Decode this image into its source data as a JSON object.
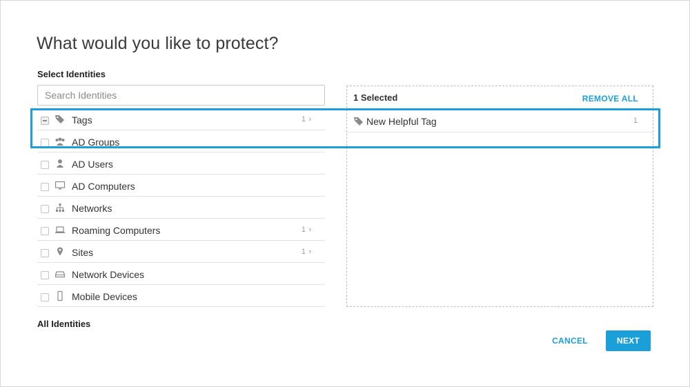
{
  "dialog": {
    "title": "What would you like to protect?",
    "section_label": "Select Identities",
    "footer_label": "All Identities"
  },
  "search": {
    "placeholder": "Search Identities",
    "value": ""
  },
  "identity_list": [
    {
      "label": "Tags",
      "icon": "tag-icon",
      "count": "1",
      "has_chevron": true,
      "checkbox": "partial"
    },
    {
      "label": "AD Groups",
      "icon": "group-icon",
      "count": "",
      "has_chevron": false,
      "checkbox": "unchecked"
    },
    {
      "label": "AD Users",
      "icon": "user-icon",
      "count": "",
      "has_chevron": false,
      "checkbox": "unchecked"
    },
    {
      "label": "AD Computers",
      "icon": "monitor-icon",
      "count": "",
      "has_chevron": false,
      "checkbox": "unchecked"
    },
    {
      "label": "Networks",
      "icon": "network-icon",
      "count": "",
      "has_chevron": false,
      "checkbox": "unchecked"
    },
    {
      "label": "Roaming Computers",
      "icon": "laptop-icon",
      "count": "1",
      "has_chevron": true,
      "checkbox": "unchecked"
    },
    {
      "label": "Sites",
      "icon": "location-pin-icon",
      "count": "1",
      "has_chevron": true,
      "checkbox": "unchecked"
    },
    {
      "label": "Network Devices",
      "icon": "network-device-icon",
      "count": "",
      "has_chevron": false,
      "checkbox": "unchecked"
    },
    {
      "label": "Mobile Devices",
      "icon": "mobile-icon",
      "count": "",
      "has_chevron": false,
      "checkbox": "unchecked"
    }
  ],
  "selected_panel": {
    "count_label": "1 Selected",
    "remove_all_label": "REMOVE ALL",
    "items": [
      {
        "label": "New Helpful Tag",
        "icon": "tag-icon",
        "count": "1"
      }
    ]
  },
  "buttons": {
    "cancel_label": "CANCEL",
    "next_label": "NEXT"
  },
  "colors": {
    "accent": "#1a9fd9",
    "text": "#333333",
    "muted": "#9a9a9a",
    "border": "#e3e3e3"
  }
}
